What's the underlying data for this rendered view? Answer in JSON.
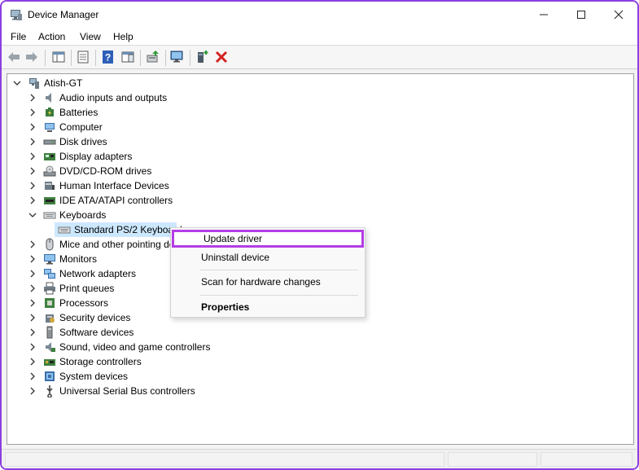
{
  "window": {
    "title": "Device Manager",
    "accent": "#8b3fe0"
  },
  "menu": [
    "File",
    "Action",
    "View",
    "Help"
  ],
  "toolbar": {
    "icons": [
      "back-arrow-icon",
      "forward-arrow-icon",
      "show-hide-tree-icon",
      "properties-icon",
      "help-icon",
      "action-pane-icon",
      "update-driver-icon",
      "scan-hardware-icon",
      "add-legacy-hardware-icon",
      "uninstall-device-icon"
    ]
  },
  "tree": {
    "root": "Atish-GT",
    "categories": [
      "Audio inputs and outputs",
      "Batteries",
      "Computer",
      "Disk drives",
      "Display adapters",
      "DVD/CD-ROM drives",
      "Human Interface Devices",
      "IDE ATA/ATAPI controllers",
      "Keyboards",
      "Mice and other pointing devices",
      "Monitors",
      "Network adapters",
      "Print queues",
      "Processors",
      "Security devices",
      "Software devices",
      "Sound, video and game controllers",
      "Storage controllers",
      "System devices",
      "Universal Serial Bus controllers"
    ],
    "keyboard_child": "Standard PS/2 Keyboard"
  },
  "context_menu": {
    "items": [
      "Update driver",
      "Uninstall device",
      "Scan for hardware changes",
      "Properties"
    ],
    "highlight_color": "#b43ee6"
  }
}
